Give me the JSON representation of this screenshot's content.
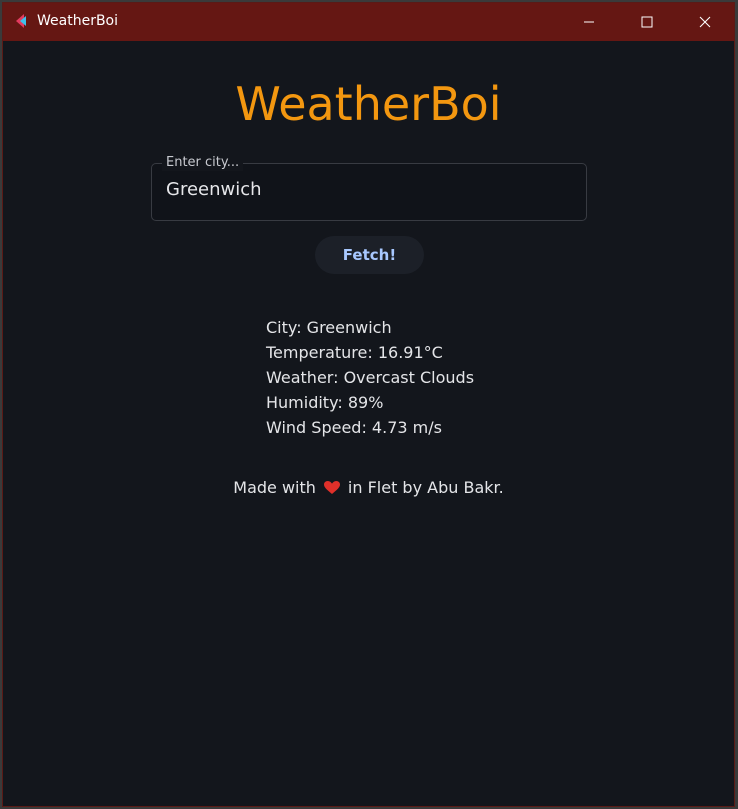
{
  "window": {
    "title": "WeatherBoi",
    "controls": {
      "minimize_icon": "minimize-icon",
      "maximize_icon": "maximize-icon",
      "close_icon": "close-icon"
    },
    "colors": {
      "titlebar": "#651713",
      "background": "#13161c"
    }
  },
  "app": {
    "heading": "WeatherBoi",
    "heading_color": "#f39710",
    "city_input": {
      "label": "Enter city...",
      "value": "Greenwich"
    },
    "fetch_button": "Fetch!",
    "weather_info": {
      "city": "City: Greenwich",
      "temperature": "Temperature: 16.91°C",
      "weather": "Weather: Overcast Clouds",
      "humidity": "Humidity: 89%",
      "wind_speed": "Wind Speed: 4.73 m/s"
    },
    "footer": {
      "prefix": "Made with",
      "icon": "heart-icon",
      "suffix": "in Flet by Abu Bakr."
    }
  }
}
